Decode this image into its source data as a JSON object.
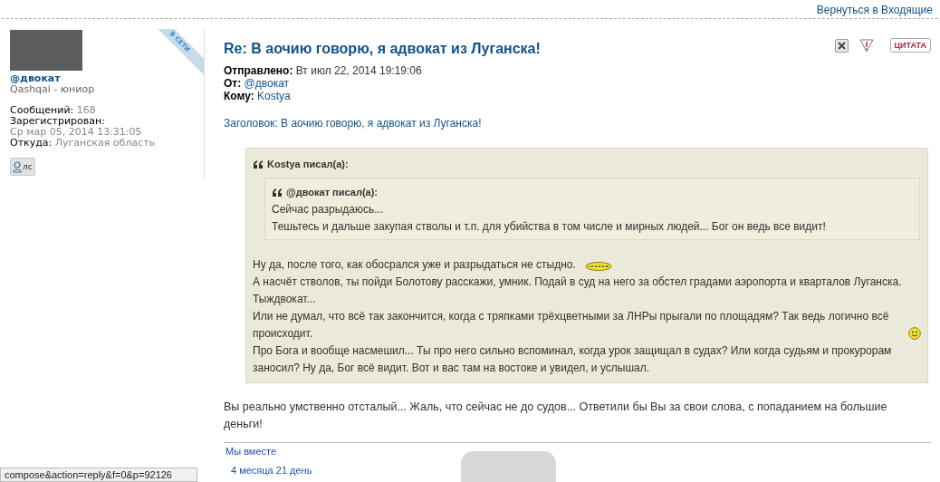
{
  "top_link": "Вернуться в Входящие",
  "author": {
    "online_badge": "В СЕТИ",
    "name": "@двокат",
    "rank": "Qashqai - юниор",
    "fields": [
      {
        "label": "Сообщений:",
        "value": "168",
        "block": false
      },
      {
        "label": "Зарегистрирован:",
        "value": "Ср мар 05, 2014 13:31:05",
        "block": true
      },
      {
        "label": "Откуда:",
        "value": "Луганская область",
        "block": false
      }
    ],
    "pm_button": "лс"
  },
  "post": {
    "title": "Re: В аочию говорю, я адвокат из Луганска!",
    "quote_button": "ЦИТАТА",
    "meta": [
      {
        "label": "Отправлено:",
        "value": "Вт июл 22, 2014 19:19:06",
        "link": false
      },
      {
        "label": "От:",
        "value": "@двокат",
        "link": true
      },
      {
        "label": "Кому:",
        "value": "Kostya",
        "link": true
      }
    ],
    "subject_line": "Заголовок: В аочию говорю, я адвокат из Луганска!",
    "quote": {
      "author": "Kostya писал(а):",
      "nested": {
        "author": "@двокат писал(а):",
        "lines": [
          "Сейчас разрыдаюсь...",
          "Тешьтесь и дальше закупая стволы и т.п. для убийства в том числе и мирных людей... Бог он ведь все видит!"
        ]
      },
      "paragraphs": [
        {
          "text": "Ну да, после того, как обосрался уже и разрыдаться не стыдно.",
          "kind": "grin_smiley"
        },
        {
          "text": "А насчёт стволов, ты пойди Болотову расскажи, умник. Подай в суд на него за обстел градами аэропорта и кварталов Луганска. Тыждвокат...",
          "kind": "plain"
        },
        {
          "text": "Или не думал, что всё так закончится, когда с тряпками трёхцветными за ЛНРы прыгали по площадям? Так ведь логично всё происходит.",
          "kind": "smile_smiley"
        },
        {
          "text": "Про Бога и вообще насмешил... Ты про него сильно вспоминал, когда урок защищал в судах? Или когда судьям и прокурорам заносил? Ну да, Бог всё видит. Вот и вас там на востоке и увидел, и услышал.",
          "kind": "plain"
        }
      ]
    },
    "reply": "Вы реально умственно отсталый... Жаль, что сейчас не до судов... Ответили бы Вы за свои слова, с попаданием на большие деньги!",
    "signature": {
      "title": "Мы вместе",
      "caption": "4 месяца 21 день"
    }
  },
  "status_bar": "compose&action=reply&f=0&p=92126"
}
